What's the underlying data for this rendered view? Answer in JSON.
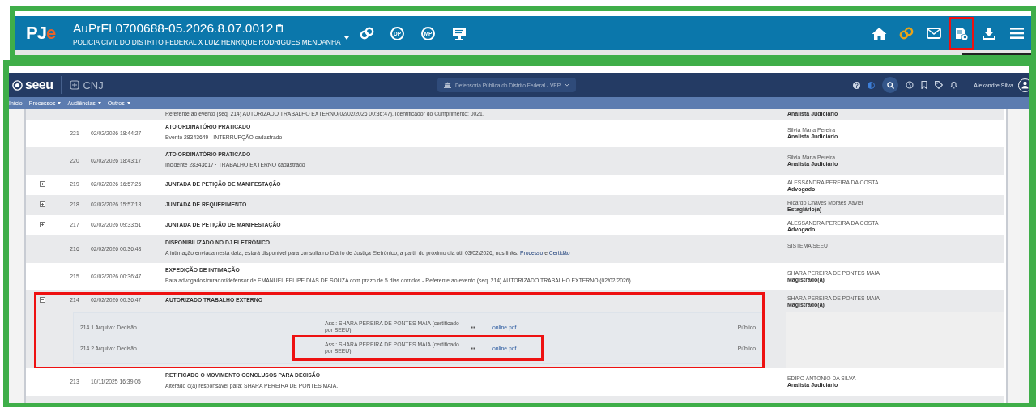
{
  "pje": {
    "logo_main": "PJ",
    "logo_accent": "e",
    "title": "AuPrFI 0700688-05.2026.8.07.0012",
    "subtitle": "POLICIA CIVIL DO DISTRITO FEDERAL X LUIZ HENRIQUE RODRIGUES MENDANHA",
    "left_tools": [
      {
        "kind": "link",
        "color": "#ffffff",
        "highlighted": false
      },
      {
        "kind": "badge",
        "text": "DP",
        "color": "#ffffff",
        "highlighted": false
      },
      {
        "kind": "badge",
        "text": "MP",
        "color": "#ffffff",
        "highlighted": false
      },
      {
        "kind": "monitor",
        "color": "#ffffff",
        "highlighted": false
      }
    ],
    "right_tools": [
      {
        "kind": "home",
        "color": "#ffffff",
        "highlighted": false
      },
      {
        "kind": "link",
        "color": "#e8a317",
        "highlighted": false
      },
      {
        "kind": "mail",
        "color": "#ffffff",
        "highlighted": false
      },
      {
        "kind": "document",
        "color": "#ffffff",
        "highlighted": true
      },
      {
        "kind": "download",
        "color": "#ffffff",
        "highlighted": false
      },
      {
        "kind": "menu",
        "color": "#ffffff",
        "highlighted": false
      }
    ]
  },
  "seeu": {
    "logo": "seeu",
    "org": "CNJ",
    "unit": "Defensoria Pública do Distrito Federal - VEP",
    "user": "Alexandre Silva",
    "nav": [
      {
        "label": "Início",
        "dropdown": false
      },
      {
        "label": "Processos",
        "dropdown": true
      },
      {
        "label": "Audiências",
        "dropdown": true
      },
      {
        "label": "Outros",
        "dropdown": true
      }
    ]
  },
  "events": [
    {
      "kind": "partial",
      "detail": "Referente ao evento (seq. 214) AUTORIZADO TRABALHO EXTERNO(02/02/2026 00:36:47). Identificador do Cumprimento: 0021.",
      "author_role": "Analista Judiciário",
      "highlighted": false
    },
    {
      "kind": "event",
      "expandable": false,
      "seq": "221",
      "date": "02/02/2026 18:44:27",
      "title": "ATO ORDINATÓRIO PRATICADO",
      "detail": [
        {
          "kind": "text",
          "text": "Evento 28343649 · INTERRUPÇÃO cadastrado"
        }
      ],
      "author": "Silvia Maria Pereira",
      "author_role": "Analista Judiciário",
      "highlighted": false
    },
    {
      "kind": "event",
      "expandable": false,
      "seq": "220",
      "date": "02/02/2026 18:43:17",
      "title": "ATO ORDINATÓRIO PRATICADO",
      "detail": [
        {
          "kind": "text",
          "text": "Incidente 28343617 · TRABALHO EXTERNO cadastrado"
        }
      ],
      "author": "Silvia Maria Pereira",
      "author_role": "Analista Judiciário",
      "highlighted": false
    },
    {
      "kind": "event",
      "expandable": true,
      "expanded": false,
      "seq": "219",
      "date": "02/02/2026 16:57:25",
      "title": "JUNTADA DE PETIÇÃO DE MANIFESTAÇÃO",
      "author": "ALESSANDRA PEREIRA DA COSTA",
      "author_role": "Advogado",
      "highlighted": false
    },
    {
      "kind": "event",
      "expandable": true,
      "expanded": false,
      "seq": "218",
      "date": "02/02/2026 15:57:13",
      "title": "JUNTADA DE REQUERIMENTO",
      "author": "Ricardo Chaves Moraes Xavier",
      "author_role": "Estagiário(a)",
      "highlighted": false
    },
    {
      "kind": "event",
      "expandable": true,
      "expanded": false,
      "seq": "217",
      "date": "02/02/2026 09:33:51",
      "title": "JUNTADA DE PETIÇÃO DE MANIFESTAÇÃO",
      "author": "ALESSANDRA PEREIRA DA COSTA",
      "author_role": "Advogado",
      "highlighted": false
    },
    {
      "kind": "event",
      "expandable": false,
      "seq": "216",
      "date": "02/02/2026 00:36:48",
      "title": "DISPONIBILIZADO NO DJ ELETRÔNICO",
      "detail": [
        {
          "kind": "text",
          "text": "A intimação enviada nesta data, estará disponível para consulta no Diário de Justiça Eletrônico, a partir do próximo dia útil 03/02/2026, nos links: "
        },
        {
          "kind": "link",
          "text": "Processo"
        },
        {
          "kind": "text",
          "text": " e "
        },
        {
          "kind": "link",
          "text": "Certidão"
        }
      ],
      "author": "SISTEMA SEEU",
      "highlighted": false
    },
    {
      "kind": "event",
      "expandable": false,
      "seq": "215",
      "date": "02/02/2026 00:36:47",
      "title": "EXPEDIÇÃO DE INTIMAÇÃO",
      "detail": [
        {
          "kind": "text",
          "text": "Para advogados/curador/defensor de EMANUEL FELIPE DIAS DE SOUZA com prazo de 5 dias corridos - Referente ao evento (seq. 214) AUTORIZADO TRABALHO EXTERNO (02/02/2026)"
        }
      ],
      "author": "SHARA PEREIRA DE PONTES MAIA",
      "author_role": "Magistrado(a)",
      "highlighted": false
    },
    {
      "kind": "event",
      "expandable": true,
      "expanded": true,
      "seq": "214",
      "date": "02/02/2026 00:36:47",
      "title": "AUTORIZADO TRABALHO EXTERNO",
      "author": "SHARA PEREIRA DE PONTES MAIA",
      "author_role": "Magistrado(a)",
      "highlighted": true,
      "files": [
        {
          "label": "214.1 Arquivo: Decisão",
          "signer": "Ass.: SHARA PEREIRA DE PONTES MAIA (certificado por SEEU)",
          "file": "online.pdf",
          "visibility": "Público",
          "highlighted": false
        },
        {
          "label": "214.2 Arquivo: Decisão",
          "signer": "Ass.: SHARA PEREIRA DE PONTES MAIA (certificado por SEEU)",
          "file": "online.pdf",
          "visibility": "Público",
          "highlighted": true
        }
      ]
    },
    {
      "kind": "event",
      "expandable": false,
      "seq": "213",
      "date": "10/11/2025 16:39:05",
      "title": "RETIFICADO O MOVIMENTO CONCLUSOS PARA DECISÃO",
      "detail": [
        {
          "kind": "text",
          "text": "Alterado o(a) responsável para: SHARA PEREIRA DE PONTES MAIA."
        }
      ],
      "author": "EDIPO ANTONIO DA SILVA",
      "author_role": "Analista Judiciário",
      "highlighted": false
    }
  ]
}
